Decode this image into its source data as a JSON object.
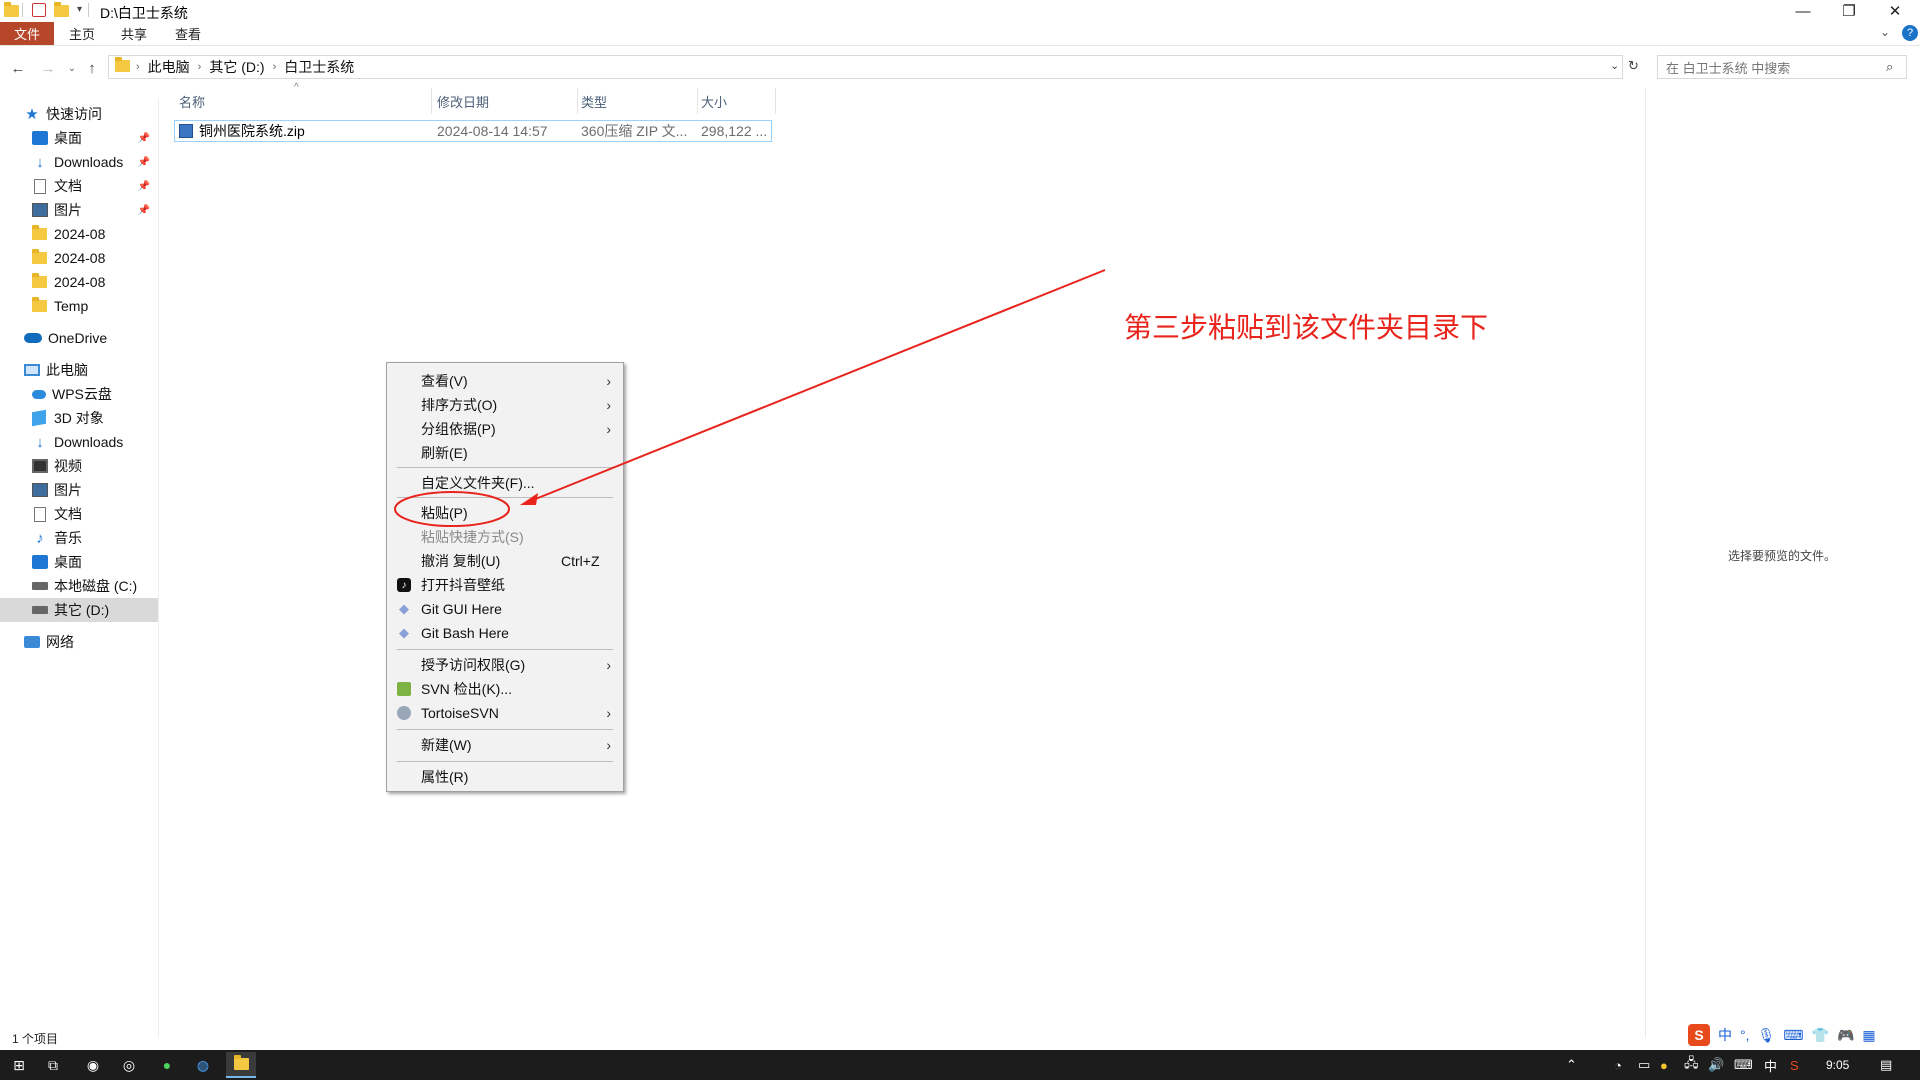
{
  "titlebar": {
    "path": "D:\\白卫士系统",
    "min": "—",
    "restore": "❐",
    "close": "✕"
  },
  "ribbon": {
    "tabs": [
      "文件",
      "主页",
      "共享",
      "查看"
    ]
  },
  "address": {
    "crumbs": [
      "此电脑",
      "其它 (D:)",
      "白卫士系统"
    ],
    "search_placeholder": "在 白卫士系统 中搜索"
  },
  "nav": {
    "quick_access": "快速访问",
    "quick_items": [
      "桌面",
      "Downloads",
      "文档",
      "图片",
      "2024-08",
      "2024-08",
      "2024-08",
      "Temp"
    ],
    "onedrive": "OneDrive",
    "this_pc": "此电脑",
    "pc_items": [
      "WPS云盘",
      "3D 对象",
      "Downloads",
      "视频",
      "图片",
      "文档",
      "音乐",
      "桌面",
      "本地磁盘 (C:)",
      "其它 (D:)"
    ],
    "network": "网络"
  },
  "columns": [
    "名称",
    "修改日期",
    "类型",
    "大小"
  ],
  "files": [
    {
      "name": "铜州医院系统.zip",
      "date": "2024-08-14 14:57",
      "type": "360压缩 ZIP 文...",
      "size": "298,122 ..."
    }
  ],
  "context_menu": {
    "items": [
      {
        "label": "查看(V)",
        "submenu": true
      },
      {
        "label": "排序方式(O)",
        "submenu": true
      },
      {
        "label": "分组依据(P)",
        "submenu": true
      },
      {
        "label": "刷新(E)"
      },
      {
        "label": "自定义文件夹(F)..."
      },
      {
        "label": "粘贴(P)"
      },
      {
        "label": "粘贴快捷方式(S)",
        "disabled": true
      },
      {
        "label": "撤消 复制(U)",
        "accel": "Ctrl+Z"
      },
      {
        "label": "打开抖音壁纸",
        "icon": "tiktok-icon"
      },
      {
        "label": "Git GUI Here",
        "icon": "git-icon"
      },
      {
        "label": "Git Bash Here",
        "icon": "git-icon"
      },
      {
        "label": "授予访问权限(G)",
        "submenu": true
      },
      {
        "label": "SVN 检出(K)...",
        "icon": "svn-icon"
      },
      {
        "label": "TortoiseSVN",
        "submenu": true,
        "icon": "tortoise-icon"
      },
      {
        "label": "新建(W)",
        "submenu": true
      },
      {
        "label": "属性(R)"
      }
    ]
  },
  "annotation": {
    "text": "第三步粘贴到该文件夹目录下",
    "color": "#e8241c"
  },
  "preview_text": "选择要预览的文件。",
  "status": "1 个项目",
  "taskbar": {
    "clock": "9:05",
    "ime": "中",
    "ime_bar": [
      "中"
    ]
  }
}
